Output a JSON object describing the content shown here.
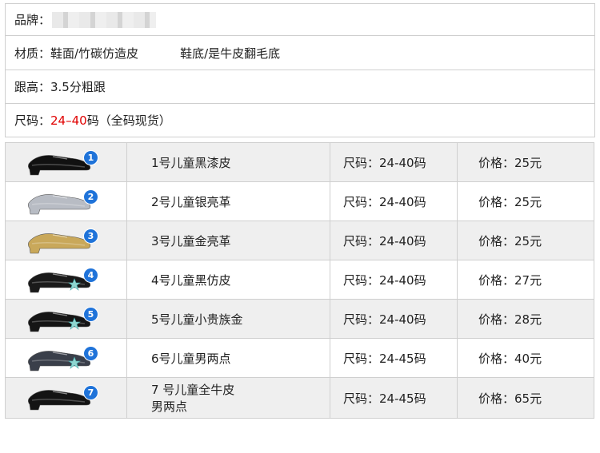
{
  "specs": {
    "brand_label": "品牌：",
    "material": "材质：鞋面/竹碳仿造皮",
    "sole": "鞋底/是牛皮翻毛底",
    "heel": "跟高：3.5分粗跟",
    "size_label": "尺码：",
    "size_range": "24–40",
    "size_suffix": " 码（全码现货）"
  },
  "colors": {
    "badge": "#1f73d9",
    "highlight": "#e00000",
    "row_alt": "#efefef"
  },
  "products": [
    {
      "badge": "1",
      "name": "1号儿童黑漆皮",
      "size": "尺码：24-40码",
      "price": "价格：25元",
      "shoe_color": "#111111",
      "icon": "black-patent-shoe-icon"
    },
    {
      "badge": "2",
      "name": "2号儿童银亮革",
      "size": "尺码：24-40码",
      "price": "价格：25元",
      "shoe_color": "#b8bcc4",
      "icon": "silver-shoe-icon"
    },
    {
      "badge": "3",
      "name": "3号儿童金亮革",
      "size": "尺码：24-40码",
      "price": "价格：25元",
      "shoe_color": "#c9a85a",
      "icon": "gold-shoe-icon"
    },
    {
      "badge": "4",
      "name": "4号儿童黑仿皮",
      "size": "尺码：24-40码",
      "price": "价格：27元",
      "shoe_color": "#1a1a1a",
      "icon": "black-faux-leather-shoe-icon"
    },
    {
      "badge": "5",
      "name": "5号儿童小贵族金",
      "size": "尺码：24-40码",
      "price": "价格：28元",
      "shoe_color": "#151515",
      "icon": "black-gold-shoe-icon"
    },
    {
      "badge": "6",
      "name": "6号儿童男两点",
      "size": "尺码：24-45码",
      "price": "价格：40元",
      "shoe_color": "#3a3f4a",
      "icon": "two-tone-shoe-icon"
    },
    {
      "badge": "7",
      "name_line1": "7 号儿童全牛皮",
      "name_line2": "男两点",
      "size": "尺码：24-45码",
      "price": "价格：65元",
      "shoe_color": "#141414",
      "icon": "leather-shoe-icon"
    }
  ]
}
